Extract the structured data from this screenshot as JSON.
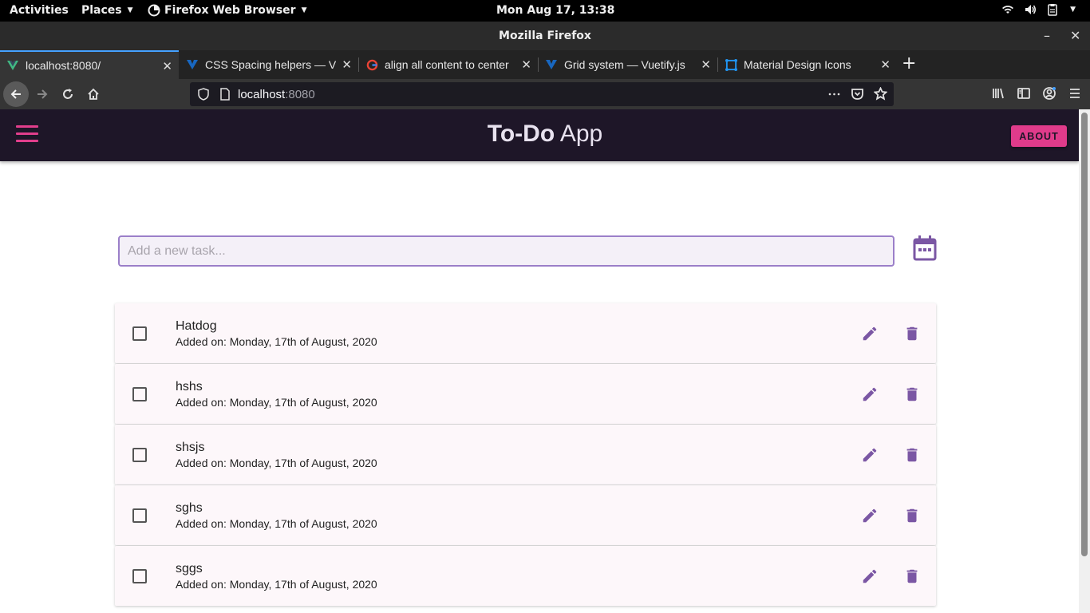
{
  "system_bar": {
    "activities": "Activities",
    "places": "Places",
    "browser_app": "Firefox Web Browser",
    "clock": "Mon Aug 17, 13:38",
    "tray_icons": [
      "wifi-icon",
      "volume-icon",
      "clipboard-icon"
    ]
  },
  "window": {
    "title": "Mozilla Firefox"
  },
  "tabs": [
    {
      "label": "localhost:8080/",
      "icon": "vue-icon",
      "active": true
    },
    {
      "label": "CSS Spacing helpers — V",
      "icon": "vuetify-icon",
      "active": false
    },
    {
      "label": "align all content to center",
      "icon": "google-icon",
      "active": false
    },
    {
      "label": "Grid system — Vuetify.js",
      "icon": "vuetify-icon",
      "active": false
    },
    {
      "label": "Material Design Icons",
      "icon": "mdi-icon",
      "active": false
    }
  ],
  "navbar": {
    "url_host": "localhost",
    "url_port": ":8080"
  },
  "app": {
    "title_bold": "To-Do",
    "title_light": "App",
    "about_label": "ABOUT",
    "input_placeholder": "Add a new task...",
    "accent_color": "#e03b8b",
    "icon_color": "#7b57a4",
    "header_color": "#1e1628",
    "tasks": [
      {
        "title": "Hatdog",
        "date": "Added on: Monday, 17th of August, 2020",
        "done": false
      },
      {
        "title": "hshs",
        "date": "Added on: Monday, 17th of August, 2020",
        "done": false
      },
      {
        "title": "shsjs",
        "date": "Added on: Monday, 17th of August, 2020",
        "done": false
      },
      {
        "title": "sghs",
        "date": "Added on: Monday, 17th of August, 2020",
        "done": false
      },
      {
        "title": "sggs",
        "date": "Added on: Monday, 17th of August, 2020",
        "done": false
      }
    ]
  }
}
